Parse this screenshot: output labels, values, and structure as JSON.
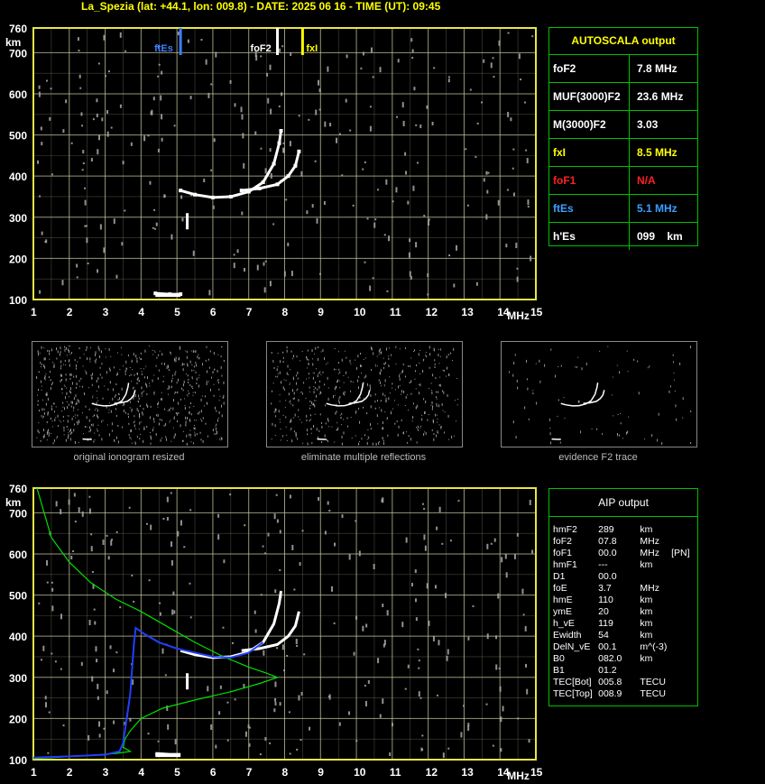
{
  "header": {
    "title": "La_Spezia (lat: +44.1, lon: 009.8) - DATE: 2025 06 16 - TIME (UT): 09:45"
  },
  "chart_data": [
    {
      "type": "scatter",
      "title": "",
      "xlabel": "MHz",
      "ylabel": "km",
      "xlim": [
        1,
        15
      ],
      "ylim": [
        100,
        760
      ],
      "x_ticks": [
        "1",
        "2",
        "3",
        "4",
        "5",
        "6",
        "7",
        "8",
        "9",
        "10",
        "11",
        "12",
        "13",
        "14",
        "15"
      ],
      "y_ticks": [
        "100",
        "200",
        "300",
        "400",
        "500",
        "600",
        "700",
        "760"
      ],
      "markers": [
        {
          "name": "ftEs",
          "x": 5.1,
          "color": "#3a7fff"
        },
        {
          "name": "foF2",
          "x": 7.8,
          "color": "#ffffff"
        },
        {
          "name": "fxI",
          "x": 8.5,
          "color": "#ffff00"
        }
      ],
      "series": [
        {
          "name": "O-trace",
          "points": [
            [
              5.1,
              365
            ],
            [
              5.5,
              355
            ],
            [
              6,
              348
            ],
            [
              6.5,
              350
            ],
            [
              7,
              362
            ],
            [
              7.4,
              385
            ],
            [
              7.7,
              430
            ],
            [
              7.85,
              480
            ],
            [
              7.9,
              510
            ]
          ]
        },
        {
          "name": "X-trace",
          "points": [
            [
              6.8,
              365
            ],
            [
              7.3,
              370
            ],
            [
              7.8,
              380
            ],
            [
              8.1,
              400
            ],
            [
              8.3,
              425
            ],
            [
              8.4,
              460
            ]
          ]
        },
        {
          "name": "Es-trace",
          "points": [
            [
              4.4,
              115
            ],
            [
              4.8,
              113
            ],
            [
              5.1,
              113
            ]
          ]
        }
      ]
    },
    {
      "type": "line",
      "title": "",
      "xlabel": "MHz",
      "ylabel": "km",
      "xlim": [
        1,
        15
      ],
      "ylim": [
        100,
        760
      ],
      "x_ticks": [
        "1",
        "2",
        "3",
        "4",
        "5",
        "6",
        "7",
        "8",
        "9",
        "10",
        "11",
        "12",
        "13",
        "14",
        "15"
      ],
      "y_ticks": [
        "100",
        "200",
        "300",
        "400",
        "500",
        "600",
        "700",
        "760"
      ],
      "series": [
        {
          "name": "profile",
          "color": "#00e000",
          "points": [
            [
              1.1,
              760
            ],
            [
              1.5,
              640
            ],
            [
              2,
              580
            ],
            [
              2.6,
              530
            ],
            [
              3.3,
              490
            ],
            [
              4,
              460
            ],
            [
              4.8,
              420
            ],
            [
              5.5,
              385
            ],
            [
              6.3,
              350
            ],
            [
              7,
              325
            ],
            [
              7.5,
              310
            ],
            [
              7.8,
              300
            ],
            [
              7.3,
              285
            ],
            [
              6.5,
              265
            ],
            [
              5.5,
              245
            ],
            [
              4.6,
              225
            ],
            [
              4,
              200
            ],
            [
              3.7,
              170
            ],
            [
              3.55,
              150
            ],
            [
              3.5,
              130
            ],
            [
              3.7,
              120
            ],
            [
              3.3,
              115
            ],
            [
              2.5,
              110
            ],
            [
              1.5,
              105
            ],
            [
              1,
              103
            ]
          ]
        },
        {
          "name": "blue",
          "color": "#2040ff",
          "points": [
            [
              1,
              105
            ],
            [
              2,
              108
            ],
            [
              3,
              112
            ],
            [
              3.4,
              120
            ],
            [
              3.5,
              140
            ],
            [
              3.55,
              170
            ],
            [
              3.7,
              260
            ],
            [
              3.8,
              380
            ],
            [
              3.85,
              420
            ],
            [
              4.1,
              405
            ],
            [
              4.5,
              385
            ],
            [
              5,
              370
            ],
            [
              5.5,
              360
            ],
            [
              6,
              350
            ],
            [
              6.5,
              348
            ],
            [
              7,
              360
            ],
            [
              7.4,
              385
            ]
          ]
        }
      ]
    }
  ],
  "autoscala": {
    "title": "AUTOSCALA output",
    "rows": [
      {
        "key": "foF2",
        "value": "7.8 MHz",
        "key_color": "#ffffff",
        "value_color": "#ffffff"
      },
      {
        "key": "MUF(3000)F2",
        "value": "23.6 MHz",
        "key_color": "#ffffff",
        "value_color": "#ffffff"
      },
      {
        "key": "M(3000)F2",
        "value": "3.03",
        "key_color": "#ffffff",
        "value_color": "#ffffff"
      },
      {
        "key": "fxI",
        "value": "8.5 MHz",
        "key_color": "#ffff00",
        "value_color": "#ffff00"
      },
      {
        "key": "foF1",
        "value": "N/A",
        "key_color": "#ff2020",
        "value_color": "#ff2020"
      },
      {
        "key": "ftEs",
        "value": "5.1 MHz",
        "key_color": "#3a9fff",
        "value_color": "#3a9fff"
      },
      {
        "key": "h'Es",
        "value": "099    km",
        "key_color": "#ffffff",
        "value_color": "#ffffff"
      }
    ]
  },
  "thumbnails": [
    {
      "caption": "original ionogram resized"
    },
    {
      "caption": "eliminate multiple reflections"
    },
    {
      "caption": "evidence F2 trace"
    }
  ],
  "aip": {
    "title": "AIP output",
    "rows": [
      [
        "hmF2",
        "289",
        "km",
        ""
      ],
      [
        "foF2",
        "07.8",
        "MHz",
        ""
      ],
      [
        "foF1",
        "00.0",
        "MHz",
        "[PN]"
      ],
      [
        "hmF1",
        "---",
        "km",
        ""
      ],
      [
        "D1",
        "00.0",
        "",
        ""
      ],
      [
        "foE",
        "3.7",
        "MHz",
        ""
      ],
      [
        "hmE",
        "110",
        "km",
        ""
      ],
      [
        "ymE",
        "20",
        "km",
        ""
      ],
      [
        "h_vE",
        "119",
        "km",
        ""
      ],
      [
        "Ewidth",
        "54",
        "km",
        ""
      ],
      [
        "DelN_vE",
        "00.1",
        "m^(-3)",
        ""
      ],
      [
        "B0",
        "082.0",
        "km",
        ""
      ],
      [
        "B1",
        "01.2",
        "",
        ""
      ],
      [
        "TEC[Bot]",
        "005.8",
        "TECU",
        ""
      ],
      [
        "TEC[Top]",
        "008.9",
        "TECU",
        ""
      ]
    ]
  },
  "colors": {
    "grid": "#c8c8a0",
    "frame": "#e6e64a",
    "table_border": "#00c000"
  }
}
